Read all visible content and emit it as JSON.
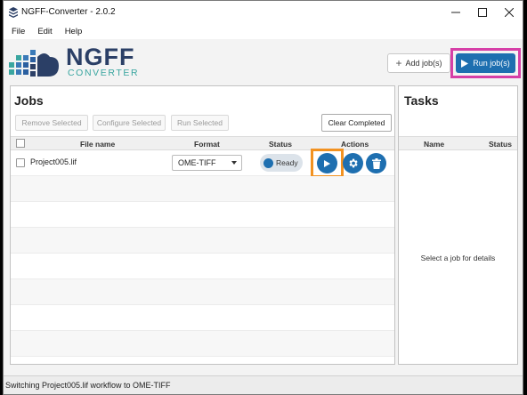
{
  "window": {
    "title": "NGFF-Converter - 2.0.2"
  },
  "menu": [
    "File",
    "Edit",
    "Help"
  ],
  "logo": {
    "line1": "NGFF",
    "line2": "CONVERTER"
  },
  "header": {
    "add_label": "Add job(s)",
    "run_label": "Run job(s)"
  },
  "jobs": {
    "title": "Jobs",
    "toolbar": {
      "remove": "Remove Selected",
      "configure": "Configure Selected",
      "run": "Run Selected",
      "clear": "Clear Completed"
    },
    "columns": {
      "file": "File name",
      "format": "Format",
      "status": "Status",
      "actions": "Actions"
    },
    "rows": [
      {
        "file": "Project005.lif",
        "format": "OME-TIFF",
        "status": "Ready"
      }
    ]
  },
  "tasks": {
    "title": "Tasks",
    "columns": {
      "name": "Name",
      "status": "Status"
    },
    "empty": "Select a job for details"
  },
  "statusbar": {
    "text": "Switching Project005.lif workflow to OME-TIFF"
  },
  "colors": {
    "accent": "#1e6fb0",
    "run_highlight": "#d63fa7",
    "action_highlight": "#f29221"
  },
  "icons": [
    "app-icon",
    "minimize-icon",
    "maximize-icon",
    "close-icon",
    "plus-icon",
    "play-icon",
    "gear-icon",
    "trash-icon"
  ]
}
